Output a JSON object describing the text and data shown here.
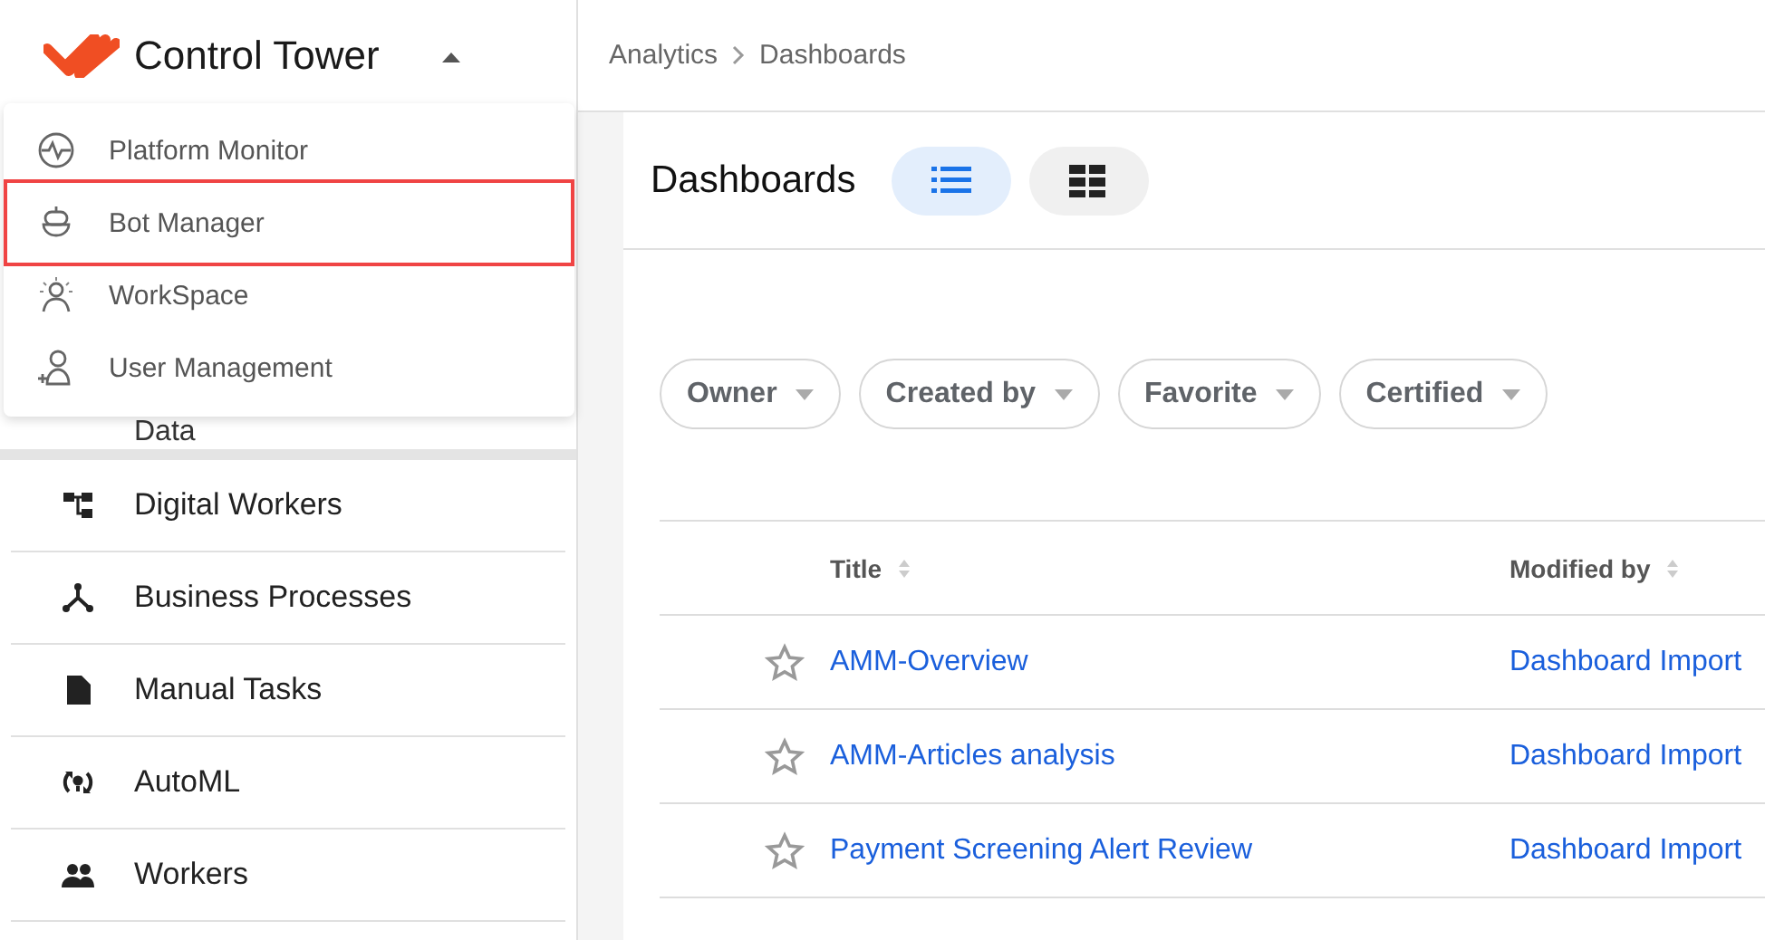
{
  "header": {
    "app_title": "Control Tower"
  },
  "app_menu": {
    "expanded": true,
    "items": [
      {
        "label": "Platform Monitor",
        "selected": false
      },
      {
        "label": "Bot Manager",
        "selected": true
      },
      {
        "label": "WorkSpace",
        "selected": false
      },
      {
        "label": "User Management",
        "selected": false
      }
    ]
  },
  "sidebar": {
    "partial_item": "Data",
    "items": [
      {
        "label": "Digital Workers"
      },
      {
        "label": "Business Processes"
      },
      {
        "label": "Manual Tasks"
      },
      {
        "label": "AutoML"
      },
      {
        "label": "Workers"
      }
    ]
  },
  "breadcrumb": [
    "Analytics",
    "Dashboards"
  ],
  "page": {
    "title": "Dashboards",
    "view_toggle": [
      {
        "kind": "list",
        "selected": true
      },
      {
        "kind": "grid",
        "selected": false
      }
    ]
  },
  "filters": [
    "Owner",
    "Created by",
    "Favorite",
    "Certified"
  ],
  "table": {
    "columns": [
      "Title",
      "Modified by"
    ],
    "rows": [
      {
        "favorite": false,
        "title": "AMM-Overview",
        "modified_by": "Dashboard Import"
      },
      {
        "favorite": false,
        "title": "AMM-Articles analysis",
        "modified_by": "Dashboard Import"
      },
      {
        "favorite": false,
        "title": "Payment Screening Alert Review",
        "modified_by": "Dashboard Import"
      }
    ]
  }
}
